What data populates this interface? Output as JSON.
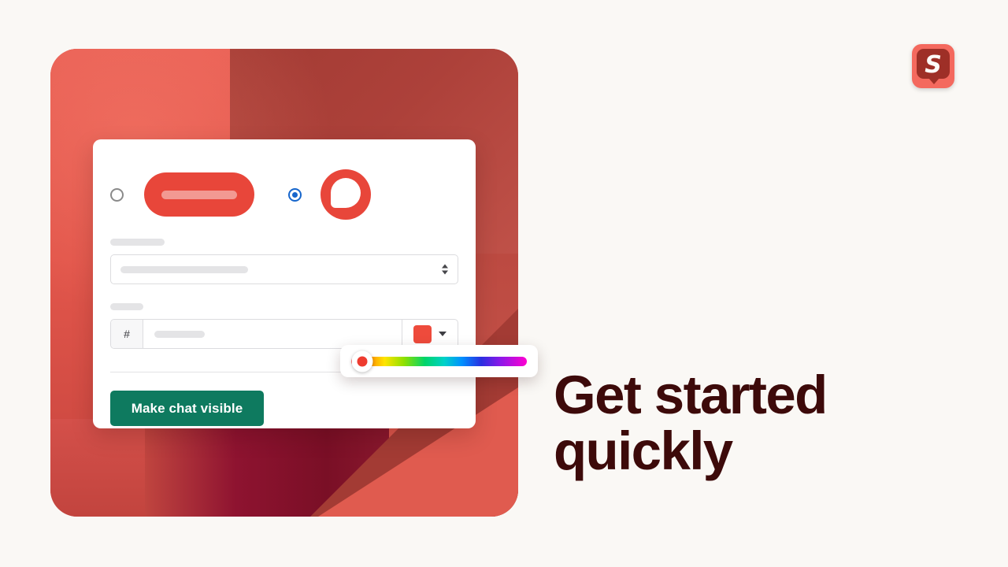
{
  "page": {
    "background_color": "#faf8f5"
  },
  "brand": {
    "logo_letter": "S",
    "logo_name": "snapengage-logo",
    "plate_color": "#f4695e",
    "bubble_color": "#9e2f27"
  },
  "hero": {
    "name": "chat-widget-preview-artwork",
    "accent_red": "#e8463a",
    "deep_maroon": "#7a0f26"
  },
  "settings_card": {
    "style_choices": [
      {
        "name": "pill-style",
        "selected": false,
        "preview": "rounded-pill-chat-button"
      },
      {
        "name": "bubble-style",
        "selected": true,
        "preview": "circular-chat-bubble-button"
      }
    ],
    "fields": [
      {
        "name": "style-select",
        "label": "",
        "value": "",
        "placeholder": "",
        "control": "select"
      },
      {
        "name": "color-hex",
        "label": "",
        "prefix": "#",
        "value": "",
        "placeholder": "",
        "swatch_color": "#ee4b3c",
        "control": "color-input"
      }
    ],
    "submit_label": "Make chat visible",
    "submit_color": "#0e7a5f"
  },
  "color_picker": {
    "name": "hue-slider-popover",
    "handle_color": "#ee3b2f",
    "handle_position_percent": 6
  },
  "headline": {
    "line1": "Get started",
    "line2": "quickly",
    "color": "#3d0a0a"
  }
}
